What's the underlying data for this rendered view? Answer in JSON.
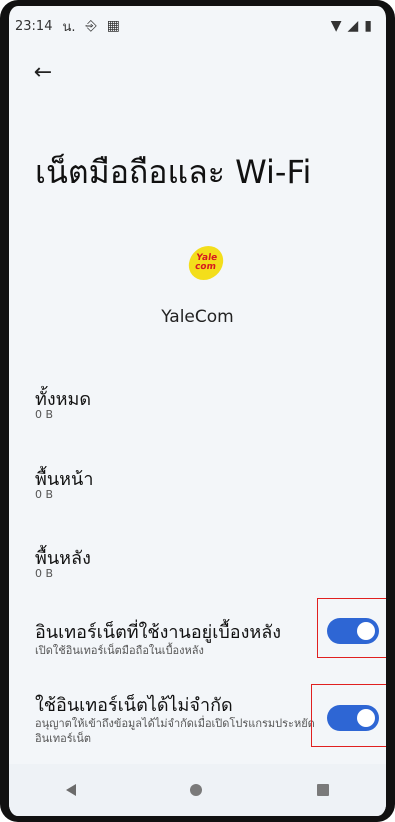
{
  "statusbar": {
    "time": "23:14",
    "extra": "น.",
    "icons_left": [
      "sim-icon",
      "image-icon"
    ],
    "icons_right": [
      "wifi-icon",
      "signal-icon",
      "battery-icon"
    ]
  },
  "header": {
    "back_icon": "←",
    "title": "เน็ตมือถือและ Wi-Fi"
  },
  "app": {
    "logo_line1": "Yale",
    "logo_line2": "com",
    "name": "YaleCom"
  },
  "usage": {
    "total_label": "ทั้งหมด",
    "total_value": "0 B",
    "foreground_label": "พื้นหน้า",
    "foreground_value": "0 B",
    "background_label": "พื้นหลัง",
    "background_value": "0 B"
  },
  "settings": {
    "background_data": {
      "title": "อินเทอร์เน็ตที่ใช้งานอยู่เบื้องหลัง",
      "subtitle": "เปิดใช้อินเทอร์เน็ตมือถือในเบื้องหลัง",
      "enabled": true
    },
    "unrestricted": {
      "title": "ใช้อินเทอร์เน็ตได้ไม่จำกัด",
      "subtitle": "อนุญาตให้เข้าถึงข้อมูลได้ไม่จำกัดเมื่อเปิดโปรแกรมประหยัดอินเทอร์เน็ต",
      "enabled": true
    }
  },
  "colors": {
    "toggle_on": "#2e66d4",
    "highlight": "#e02020",
    "background": "#f3f6f9"
  }
}
